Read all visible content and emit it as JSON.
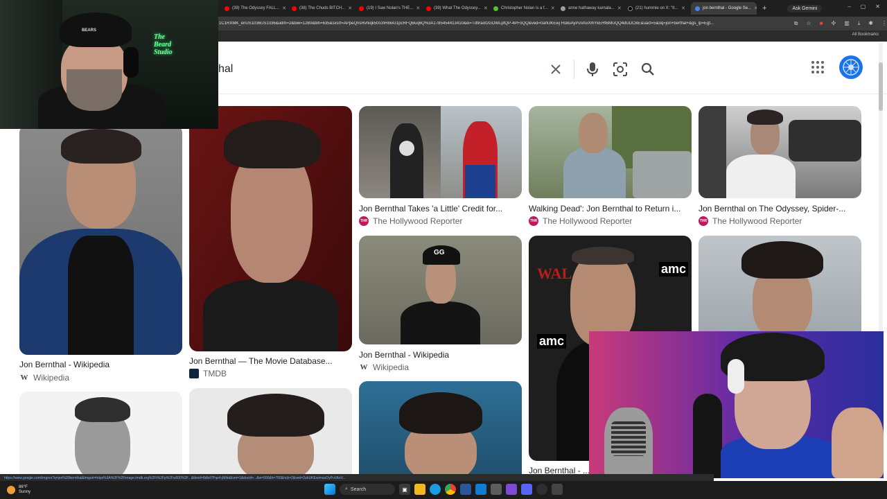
{
  "browser": {
    "tabs": [
      {
        "label": "(39) The Odyssey FALL...",
        "color": "#ff0000"
      },
      {
        "label": "(38) The Chuds BITCH...",
        "color": "#ff0000"
      },
      {
        "label": "(19) I Saw Nolan's THE...",
        "color": "#ff0000"
      },
      {
        "label": "(39) What The Odyssey...",
        "color": "#ff0000"
      },
      {
        "label": "Christopher Nolan is a f...",
        "color": "#53c22b"
      },
      {
        "label": "anne hathaway kamala...",
        "color": "#5f6368"
      },
      {
        "label": "(21) hummie on X: \"It...",
        "color": "#000000"
      },
      {
        "label": "jon bernthal - Google Se...",
        "color": "#4285f4",
        "active": true
      }
    ],
    "new_tab": "+",
    "ask_gemini": "Ask Gemini",
    "window_controls": [
      "–",
      "▢",
      "✕"
    ],
    "url": "1C1RXMK_enUS1036US1036&udm=2&biw=1280&bih=635&sxsrf=APpeQnsRvhiqk5tXchH8ivG1pcRFQBuq6Q%3A1785454413410&ei=Td9raof2GOWLptQP-4PFoQQ&ved=0ahUKEwj Hs8uAyPuVAxXlhYkEHfBMUQQ4dUDCBE&uact=5&oq=jon+berthal+&gs_lp=Egt...",
    "all_bookmarks": "All Bookmarks",
    "status_url": "https://www.google.com/imgres?q=jon%20bernthal&imgurl=https%3A%2F%2Fimage.tmdb.org%2Ft%2Fp%2Fw500%2F...&tbnid=8dhd7Pqe4-jMibd&vet=1&docid=...&w=500&h=750&hcb=2&ved=2ahUKEwimuuOyPuVAxV..."
  },
  "search": {
    "query": "hal",
    "clear_icon": "close-icon",
    "mic_icon": "mic-icon",
    "lens_icon": "lens-icon",
    "search_icon": "search-icon"
  },
  "results": [
    {
      "title": "Jon Bernthal - Wikipedia",
      "source": "Wikipedia",
      "src_icon": "W"
    },
    {
      "title": "Jon Bernthal — The Movie Database...",
      "source": "TMDB",
      "src_icon": ""
    },
    {
      "title": "Jon Bernthal Takes 'a Little' Credit for...",
      "source": "The Hollywood Reporter",
      "src_icon": "THR"
    },
    {
      "title": "Walking Dead': Jon Bernthal to Return i...",
      "source": "The Hollywood Reporter",
      "src_icon": "THR"
    },
    {
      "title": "Jon Bernthal on The Odyssey, Spider-...",
      "source": "The Hollywood Reporter",
      "src_icon": "THR"
    },
    {
      "title": "Jon Bernthal - Wikipedia",
      "source": "Wikipedia",
      "src_icon": "W"
    },
    {
      "title": "Jon Bernthal - ...",
      "source": "",
      "src_icon": ""
    }
  ],
  "photo_text": {
    "cap_logo": "GG",
    "amc": "amc",
    "walking": "WAL",
    "webcam_hat": "BEARS",
    "neon": "The\nBeard\nStudio"
  },
  "taskbar": {
    "temp": "86°F",
    "condition": "Sunny",
    "search_label": "Search"
  }
}
